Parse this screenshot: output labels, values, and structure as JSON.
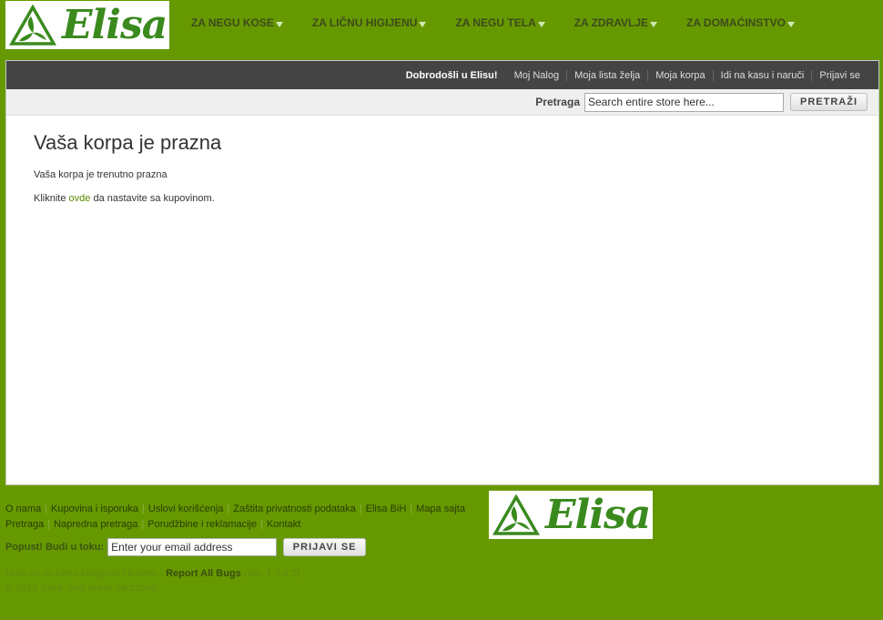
{
  "brand": {
    "name": "Elisa"
  },
  "nav": [
    {
      "label": "ZA NEGU KOSE"
    },
    {
      "label": "ZA LIČNU HIGIJENU"
    },
    {
      "label": "ZA NEGU TELA"
    },
    {
      "label": "ZA ZDRAVLJE"
    },
    {
      "label": "ZA DOMAĆINSTVO"
    }
  ],
  "topbar": {
    "welcome": "Dobrodošli u Elisu!",
    "links": [
      "Moj Nalog",
      "Moja lista želja",
      "Moja korpa",
      "Idi na kasu i naruči",
      "Prijavi se"
    ]
  },
  "search": {
    "label": "Pretraga",
    "value": "Search entire store here...",
    "button": "PRETRAŽI"
  },
  "cart": {
    "title": "Vaša korpa je prazna",
    "message": "Vaša korpa je trenutno prazna",
    "continue_before": "Kliknite ",
    "continue_link": "ovde",
    "continue_after": " da nastavite sa kupovinom."
  },
  "footer": {
    "links_row1": [
      "O nama",
      "Kupovina i isporuka",
      "Uslovi korišćenja",
      "Zaštita privatnosti podataka",
      "Elisa BiH",
      "Mapa sajta"
    ],
    "links_row2": [
      "Pretraga",
      "Napredna pretraga",
      "Porudžbine i reklamacije",
      "Kontakt"
    ],
    "newsletter_label": "Popust! Budi u toku:",
    "newsletter_value": "Enter your email address",
    "newsletter_button": "PRIJAVI SE",
    "bugs_prefix": "Help Us to Keep Magento Healthy - ",
    "bugs_link": "Report All Bugs",
    "bugs_version": " (ver. 1.7.0.2)",
    "copyright": "© 2015 Elisa. Sva prava zadržana."
  }
}
